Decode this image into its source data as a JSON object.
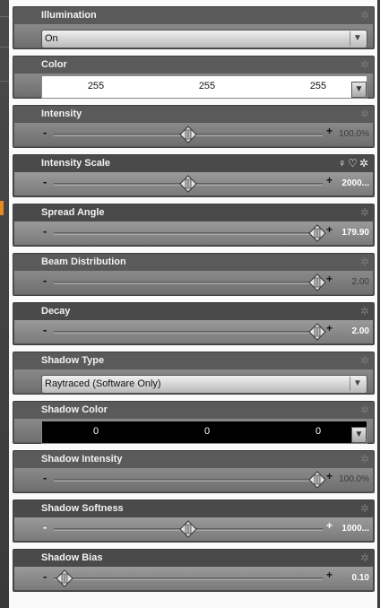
{
  "illumination": {
    "title": "Illumination",
    "value": "On"
  },
  "color": {
    "title": "Color",
    "r": "255",
    "g": "255",
    "b": "255"
  },
  "intensity": {
    "title": "Intensity",
    "value": "100.0%",
    "fraction": 0.5
  },
  "intensity_scale": {
    "title": "Intensity Scale",
    "value": "2000...",
    "fraction": 0.5
  },
  "spread_angle": {
    "title": "Spread Angle",
    "value": "179.90",
    "fraction": 0.98
  },
  "beam_distribution": {
    "title": "Beam Distribution",
    "value": "2.00",
    "fraction": 0.98
  },
  "decay": {
    "title": "Decay",
    "value": "2.00",
    "fraction": 0.98
  },
  "shadow_type": {
    "title": "Shadow Type",
    "value": "Raytraced (Software Only)"
  },
  "shadow_color": {
    "title": "Shadow Color",
    "r": "0",
    "g": "0",
    "b": "0"
  },
  "shadow_intensity": {
    "title": "Shadow Intensity",
    "value": "100.0%",
    "fraction": 0.98
  },
  "shadow_softness": {
    "title": "Shadow Softness",
    "value": "1000...",
    "fraction": 0.5
  },
  "shadow_bias": {
    "title": "Shadow Bias",
    "value": "0.10",
    "fraction": 0.04
  },
  "colors": {
    "accent": "#e58a1f",
    "panel": "#5a5a5a",
    "header_text": "#f2f2f2"
  },
  "icons": [
    "gear-icon",
    "chevron-down-icon",
    "slider-thumb-icon",
    "link-icon",
    "heart-icon"
  ]
}
